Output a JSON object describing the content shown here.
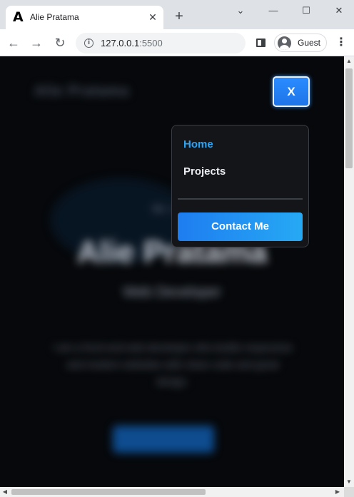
{
  "browser": {
    "tab_title": "Alie Pratama",
    "favicon_glyph": "A",
    "tab_close_glyph": "✕",
    "new_tab_glyph": "+",
    "window_controls": {
      "chevron": "⌄",
      "minimize": "—",
      "maximize": "☐",
      "close": "✕"
    },
    "nav": {
      "back": "←",
      "forward": "→",
      "reload": "↻"
    },
    "url_host": "127.0.0.1",
    "url_port": ":5500",
    "info_glyph": "i",
    "profile_name": "Guest",
    "menu_glyph": "⋮"
  },
  "page": {
    "close_button_label": "X",
    "nav_menu": {
      "items": [
        {
          "label": "Home",
          "active": true
        },
        {
          "label": "Projects",
          "active": false
        }
      ],
      "contact_label": "Contact Me"
    },
    "background_blurred": {
      "logo": "Alie Pratama",
      "greeting": "Hi, I am",
      "name": "Alie Pratama",
      "role": "Web Developer",
      "description": "I am a front-end web developer who builds responsive and modern websites with clean code and great design."
    }
  },
  "colors": {
    "accent_blue": "#2a8cff",
    "active_link": "#2aa4f4",
    "page_background": "#06080b",
    "menu_background": "#141519"
  },
  "icons": {
    "info": "info-icon",
    "profile": "profile-avatar-icon",
    "side_panel": "side-panel-icon"
  }
}
